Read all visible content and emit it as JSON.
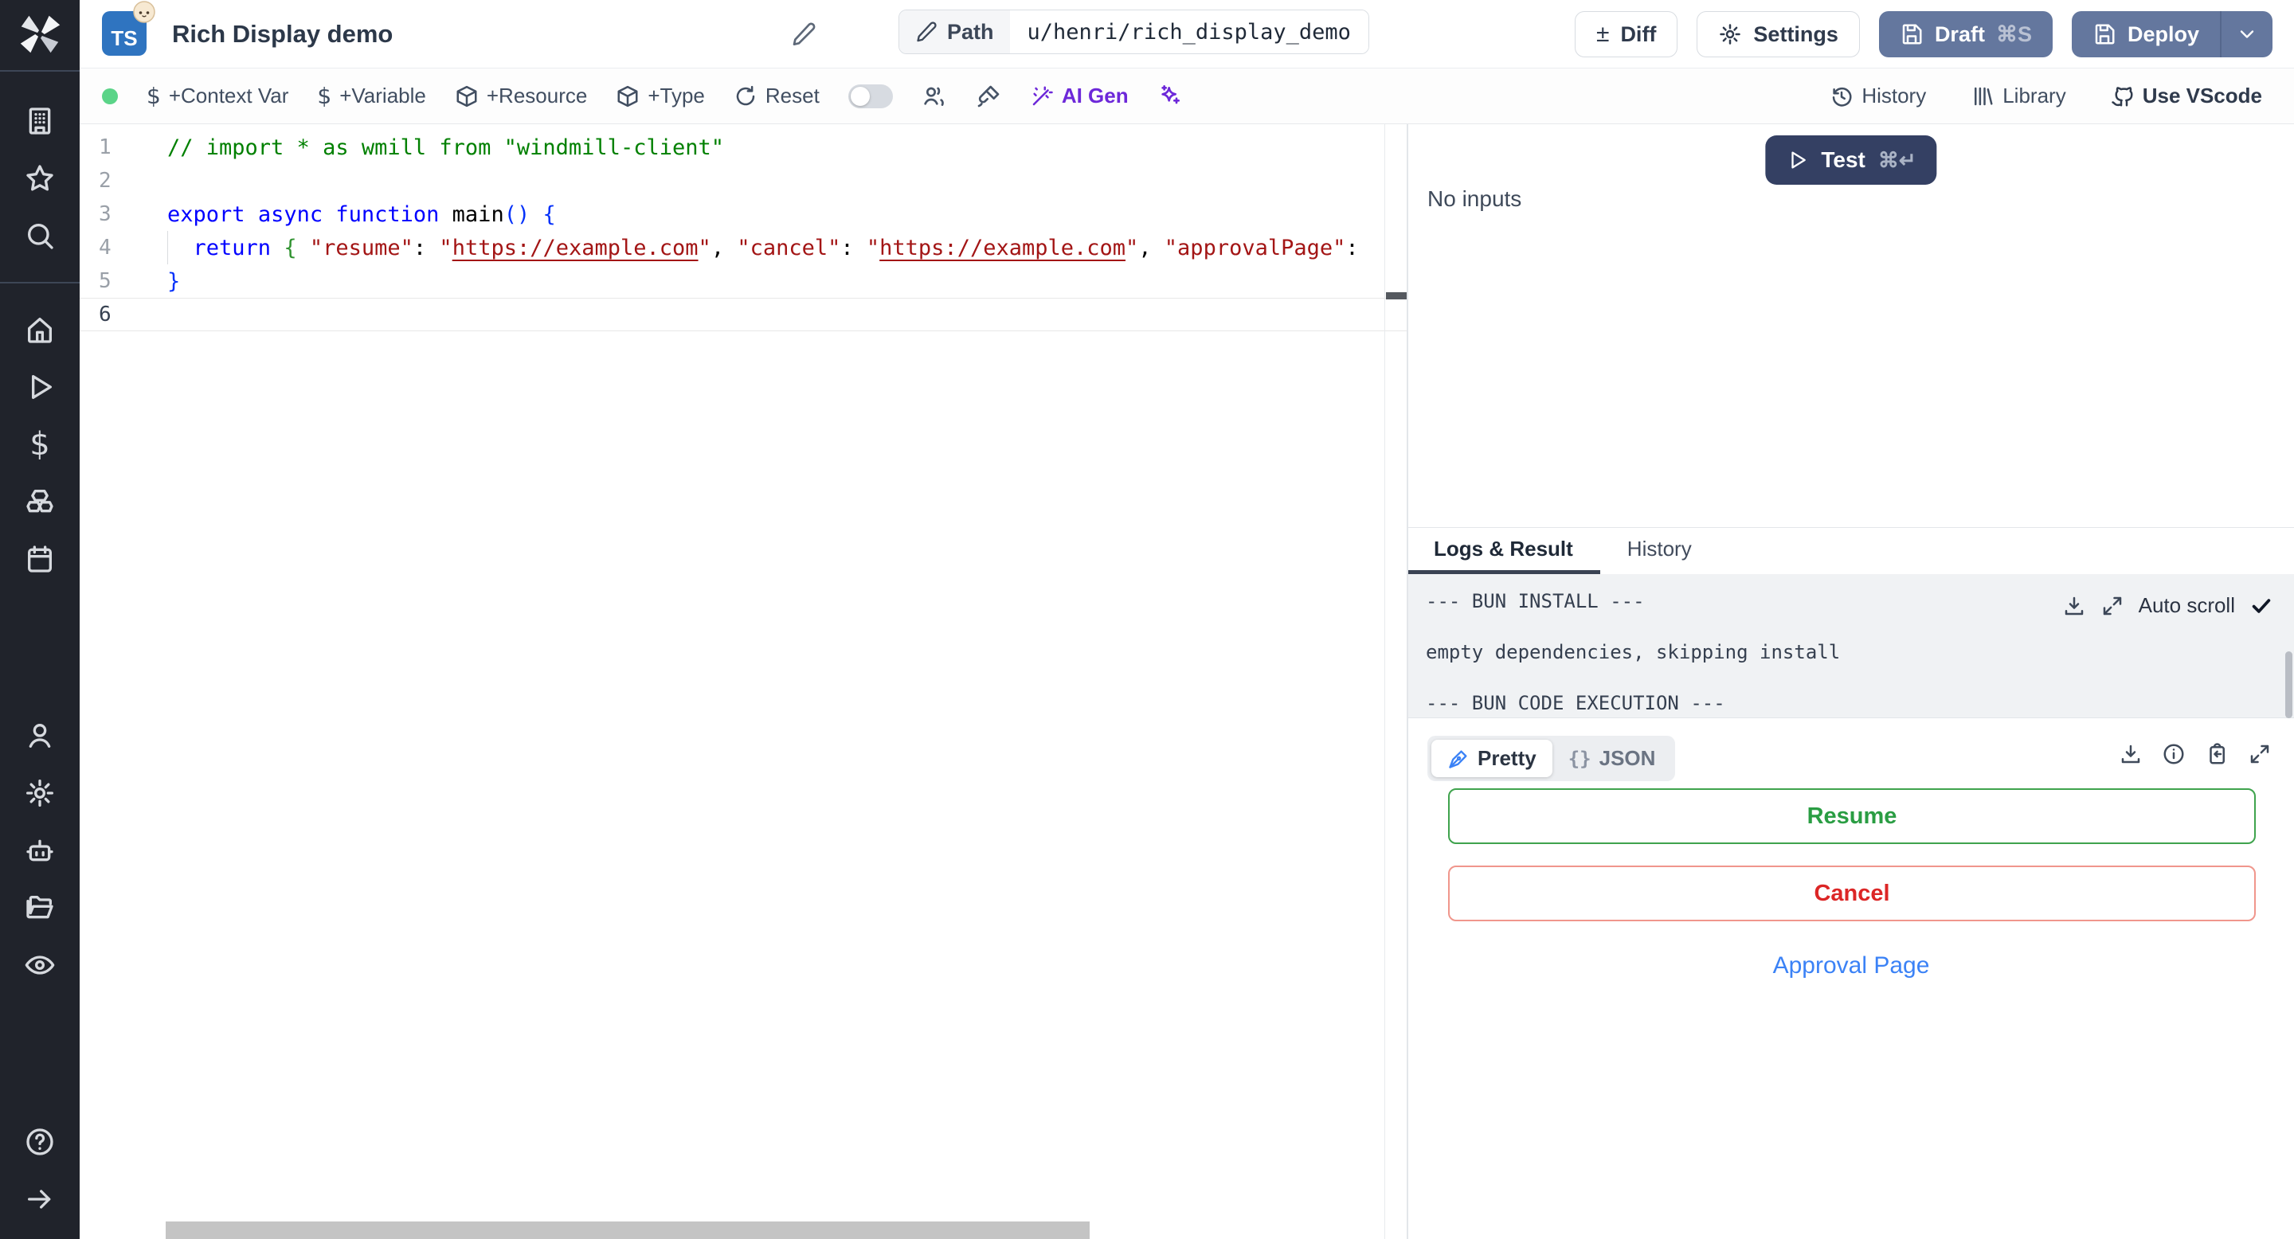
{
  "header": {
    "file_type_badge": "TS",
    "title": "Rich Display demo",
    "path_label": "Path",
    "path_value": "u/henri/rich_display_demo",
    "diff_label": "Diff",
    "diff_glyph": "±",
    "settings_label": "Settings",
    "draft_label": "Draft",
    "draft_shortcut": "⌘S",
    "deploy_label": "Deploy",
    "icons": [
      "windmill-logo",
      "typescript-file-icon",
      "bun-badge",
      "edit-pencil-icon",
      "path-pencil-icon",
      "gear-icon",
      "save-icon",
      "chevron-down-icon"
    ]
  },
  "toolbar": {
    "status": "connected",
    "dollar_glyph": "$",
    "context_var_label": "+Context Var",
    "variable_label": "+Variable",
    "resource_label": "+Resource",
    "type_label": "+Type",
    "reset_label": "Reset",
    "ai_gen_label": "AI Gen",
    "history_label": "History",
    "library_label": "Library",
    "vscode_label": "Use VScode",
    "icons": [
      "status-dot",
      "dollar-icon",
      "package-icon",
      "reset-icon",
      "toggle-off",
      "multiplayer-icon",
      "format-brush-icon",
      "wand-icon",
      "sparkles-icon",
      "history-icon",
      "library-icon",
      "github-icon"
    ]
  },
  "sidebar": {
    "icons": [
      "windmill-logo",
      "workspace-icon",
      "favorites-star-icon",
      "search-icon",
      "home-icon",
      "runs-play-icon",
      "variables-dollar-icon",
      "resources-boxes-icon",
      "schedules-calendar-icon",
      "user-icon",
      "settings-gear-icon",
      "workers-robot-icon",
      "folders-icon",
      "audit-eye-icon",
      "help-icon",
      "collapse-arrow-icon"
    ]
  },
  "editor": {
    "accent_colors": {
      "comment": "#008000",
      "keyword": "#0000ff",
      "string": "#a31515",
      "bracket1": "#0431fa",
      "bracket2": "#319331"
    },
    "lines": [
      {
        "num": "1",
        "tokens": [
          {
            "c": "cmt",
            "t": "// import * as wmill from \"windmill-client\""
          }
        ]
      },
      {
        "num": "2",
        "tokens": []
      },
      {
        "num": "3",
        "tokens": [
          {
            "c": "kw",
            "t": "export"
          },
          {
            "c": "pl",
            "t": " "
          },
          {
            "c": "kw",
            "t": "async"
          },
          {
            "c": "pl",
            "t": " "
          },
          {
            "c": "kw",
            "t": "function"
          },
          {
            "c": "pl",
            "t": " "
          },
          {
            "c": "fn",
            "t": "main"
          },
          {
            "c": "b1",
            "t": "()"
          },
          {
            "c": "pl",
            "t": " "
          },
          {
            "c": "b1",
            "t": "{"
          }
        ]
      },
      {
        "num": "4",
        "guide": true,
        "tokens": [
          {
            "c": "pl",
            "t": "  "
          },
          {
            "c": "kw",
            "t": "return"
          },
          {
            "c": "pl",
            "t": " "
          },
          {
            "c": "b2",
            "t": "{"
          },
          {
            "c": "pl",
            "t": " "
          },
          {
            "c": "str",
            "t": "\"resume\""
          },
          {
            "c": "pl",
            "t": ": "
          },
          {
            "c": "str",
            "t": "\""
          },
          {
            "c": "lnk",
            "t": "https://example.com"
          },
          {
            "c": "str",
            "t": "\""
          },
          {
            "c": "pl",
            "t": ", "
          },
          {
            "c": "str",
            "t": "\"cancel\""
          },
          {
            "c": "pl",
            "t": ": "
          },
          {
            "c": "str",
            "t": "\""
          },
          {
            "c": "lnk",
            "t": "https://example.com"
          },
          {
            "c": "str",
            "t": "\""
          },
          {
            "c": "pl",
            "t": ", "
          },
          {
            "c": "str",
            "t": "\"approvalPage\""
          },
          {
            "c": "pl",
            "t": ":"
          }
        ]
      },
      {
        "num": "5",
        "tokens": [
          {
            "c": "b1",
            "t": "}"
          }
        ]
      },
      {
        "num": "6",
        "active": true,
        "tokens": []
      }
    ]
  },
  "run_panel": {
    "test_label": "Test",
    "test_shortcut": "⌘↵",
    "no_inputs_label": "No inputs",
    "tabs": {
      "logs_result": "Logs & Result",
      "history": "History"
    },
    "log_lines": [
      "--- BUN INSTALL ---",
      "empty dependencies, skipping install",
      "--- BUN CODE EXECUTION ---"
    ],
    "autoscroll_label": "Auto scroll",
    "icons": [
      "play-icon",
      "download-icon",
      "expand-icon",
      "check-icon"
    ]
  },
  "result_panel": {
    "pretty_label": "Pretty",
    "json_label": "JSON",
    "json_glyph": "{}",
    "resume_label": "Resume",
    "cancel_label": "Cancel",
    "approval_label": "Approval Page",
    "colors": {
      "resume_green": "#2a9d43",
      "cancel_red": "#dc2626",
      "link_blue": "#3b82f6"
    },
    "icons": [
      "pen-icon",
      "braces-icon",
      "download-icon",
      "info-icon",
      "clipboard-copy-icon",
      "expand-icon"
    ]
  }
}
